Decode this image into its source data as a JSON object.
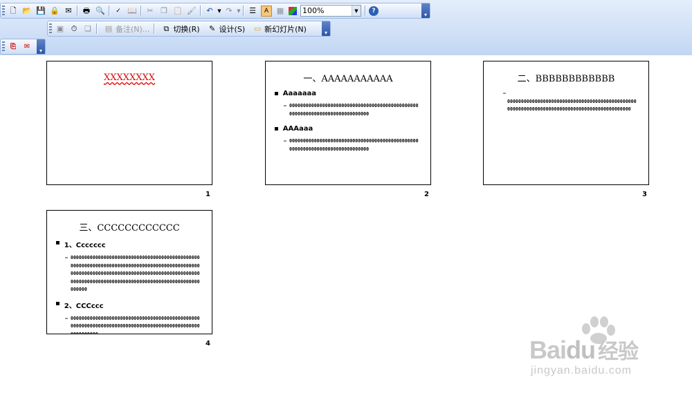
{
  "toolbar": {
    "standard_icons": [
      "new-icon",
      "open-icon",
      "save-icon",
      "permission-icon",
      "email-icon",
      "print-icon",
      "print-preview-icon",
      "spelling-icon",
      "research-icon",
      "cut-icon",
      "copy-icon",
      "paste-icon",
      "format-painter-icon",
      "undo-icon",
      "redo-icon",
      "expand-all-icon",
      "show-formatting-icon",
      "grid-icon",
      "color-grayscale-icon"
    ],
    "zoom_value": "100%",
    "help_icon": "help-icon"
  },
  "slide_sorter_toolbar": {
    "notes_label": "备注(N)...",
    "transition_label": "切换(R)",
    "design_label": "设计(S)",
    "new_slide_label": "新幻灯片(N)"
  },
  "slides": [
    {
      "number": "1",
      "title": "XXXXXXXX",
      "title_color": "#e00000"
    },
    {
      "number": "2",
      "title": "一、AAAAAAAAAAA",
      "sections": [
        {
          "bullet": "Aaaaaaa",
          "sub": "0000000000000000000000000000000000000000000000000000000000000000000000000000"
        },
        {
          "bullet": "AAAaaa",
          "sub": "0000000000000000000000000000000000000000000000000000000000000000000000000000"
        }
      ]
    },
    {
      "number": "3",
      "title": "二、BBBBBBBBBBBB",
      "sub": "00000000000000000000000000000000000000000000000000000000000000000000000000000000000000000000"
    },
    {
      "number": "4",
      "title": "三、CCCCCCCCCCCC",
      "sections": [
        {
          "bullet": "1、Ccccccc",
          "sub": "00000000000000000000000000000000000000000000000000000000000000000000000000000000000000000000000000000000000000000000000000000000000000000000000000000000000000000000000000000000000000000000000000"
        },
        {
          "bullet": "2、CCCccc",
          "sub": "00000000000000000000000000000000000000000000000000000000000000000000000000000000000000000000000000000000"
        }
      ]
    }
  ],
  "watermark": {
    "brand": "Bai",
    "brand2": "du",
    "cn": "经验",
    "url": "jingyan.baidu.com"
  }
}
